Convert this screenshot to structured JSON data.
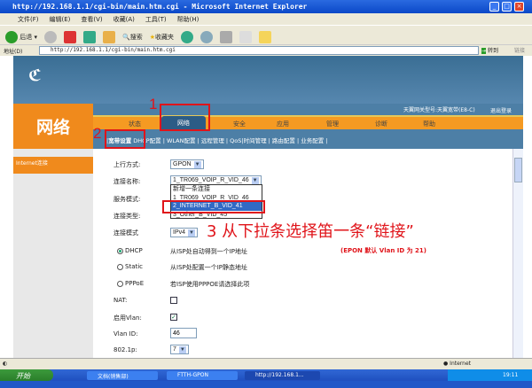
{
  "window": {
    "title": "http://192.168.1.1/cgi-bin/main.htm.cgi - Microsoft Internet Explorer"
  },
  "menu": [
    "文件(F)",
    "编辑(E)",
    "查看(V)",
    "收藏(A)",
    "工具(T)",
    "帮助(H)"
  ],
  "toolbar": {
    "back": "后退",
    "search": "搜索",
    "favorites": "收藏夹"
  },
  "address": {
    "label": "地址(D)",
    "url": "http://192.168.1.1/cgi-bin/main.htm.cgi",
    "go": "转到",
    "links": "链接"
  },
  "header": {
    "logo": "中国电信",
    "section_title": "网络",
    "model": "天翼网关型号:天翼宽带(E8-C)",
    "logout": "退出登录"
  },
  "nav": {
    "tabs": [
      "状态",
      "网络",
      "安全",
      "应用",
      "管理",
      "诊断",
      "帮助"
    ],
    "active": "网络"
  },
  "subnav": {
    "items": [
      "宽带设置",
      "DHCP配置",
      "WLAN配置",
      "远程管理",
      "QoS",
      "时间管理",
      "路由配置",
      "业务配置"
    ],
    "active": "宽带设置"
  },
  "sidebar": {
    "items": [
      "Internet连接"
    ]
  },
  "form": {
    "uplink_label": "上行方式:",
    "uplink_value": "GPON",
    "conn_name_label": "连接名称:",
    "conn_name_value": "1_TR069_VOIP_R_VID_46",
    "conn_name_options": [
      "新增一条连接",
      "1_TR069_VOIP_R_VID_46",
      "2_INTERNET_B_VID_41",
      "3_Other_B_VID_45"
    ],
    "conn_name_highlighted": "2_INTERNET_B_VID_41",
    "service_mode_label": "服务模式:",
    "conn_type_label": "连接类型:",
    "conn_mode_label": "连接模式",
    "conn_mode_value": "IPv4",
    "dhcp_label": "DHCP",
    "dhcp_desc": "从ISP处自动得到一个IP地址",
    "static_label": "Static",
    "static_desc": "从ISP处配置一个IP静态地址",
    "pppoe_label": "PPPoE",
    "pppoe_desc": "若ISP使用PPPOE请选择此项",
    "selected_mode": "DHCP",
    "nat_label": "NAT:",
    "nat_checked": false,
    "vlan_enable_label": "启用Vlan:",
    "vlan_enable_checked": true,
    "vlan_id_label": "Vlan ID:",
    "vlan_id_value": "46",
    "p8021_label": "802.1p:",
    "p8021_value": "7"
  },
  "annotations": {
    "step1": "1",
    "step2": "2",
    "step3": "3 从下拉条选择笛一条“链接”",
    "epon_note": "(EPON 默认 Vlan ID 为 21)",
    "color": "#e0141a"
  },
  "statusbar": {
    "zone": "Internet"
  },
  "taskbar": {
    "start": "开始",
    "tasks": [
      "文档(销售部)",
      "FTTH-GPON",
      "http://192.168.1..."
    ],
    "clock": "19:11"
  }
}
